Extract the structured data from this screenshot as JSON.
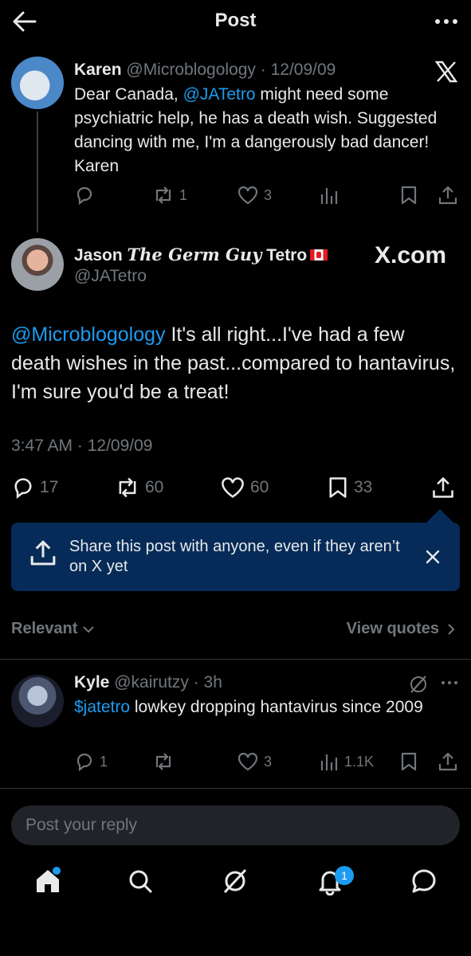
{
  "header": {
    "title": "Post"
  },
  "karen_post": {
    "name": "Karen",
    "handle": "@Microblogology",
    "date": "· 12/09/09",
    "text_before": "Dear Canada, ",
    "mention": "@JATetro",
    "text_after": " might need some psychiatric help, he has a death wish. Suggested dancing with me, I'm a dangerously bad dancer! Karen",
    "reposts": "1",
    "likes": "3"
  },
  "jason_post": {
    "name_pre": "Jason ",
    "name_styled": "The Germ Guy",
    "name_post": " Tetro",
    "handle": "@JATetro",
    "watermark": "X.com",
    "mention": "@Microblogology",
    "text": " It's all right...I've had a few death wishes in the past...compared to hantavirus, I'm sure you'd be a treat!",
    "timestamp": "3:47 AM · 12/09/09",
    "replies": "17",
    "reposts": "60",
    "likes": "60",
    "bookmarks": "33"
  },
  "share_banner": {
    "text": "Share this post with anyone, even if they aren’t on X yet"
  },
  "sort": {
    "relevant_label": "Relevant",
    "view_quotes_label": "View quotes"
  },
  "kyle_reply": {
    "name": "Kyle",
    "handle": "@kairutzy",
    "time": "· 3h",
    "cashtag": "$jatetro",
    "text": " lowkey dropping hantavirus since 2009",
    "replies": "1",
    "likes": "3",
    "views": "1.1K"
  },
  "reply_box": {
    "placeholder": "Post your reply"
  },
  "nav": {
    "notifications_badge": "1"
  },
  "colors": {
    "accent": "#1d9bf0",
    "banner": "#062b58",
    "background": "#000000"
  },
  "icons": [
    "back-arrow-icon",
    "more-icon",
    "x-logo-icon",
    "reply-icon",
    "repost-icon",
    "like-icon",
    "views-icon",
    "bookmark-icon",
    "share-icon",
    "close-icon",
    "chevron-down-icon",
    "chevron-right-icon",
    "grok-icon",
    "home-icon",
    "search-icon",
    "notifications-icon",
    "messages-icon"
  ]
}
